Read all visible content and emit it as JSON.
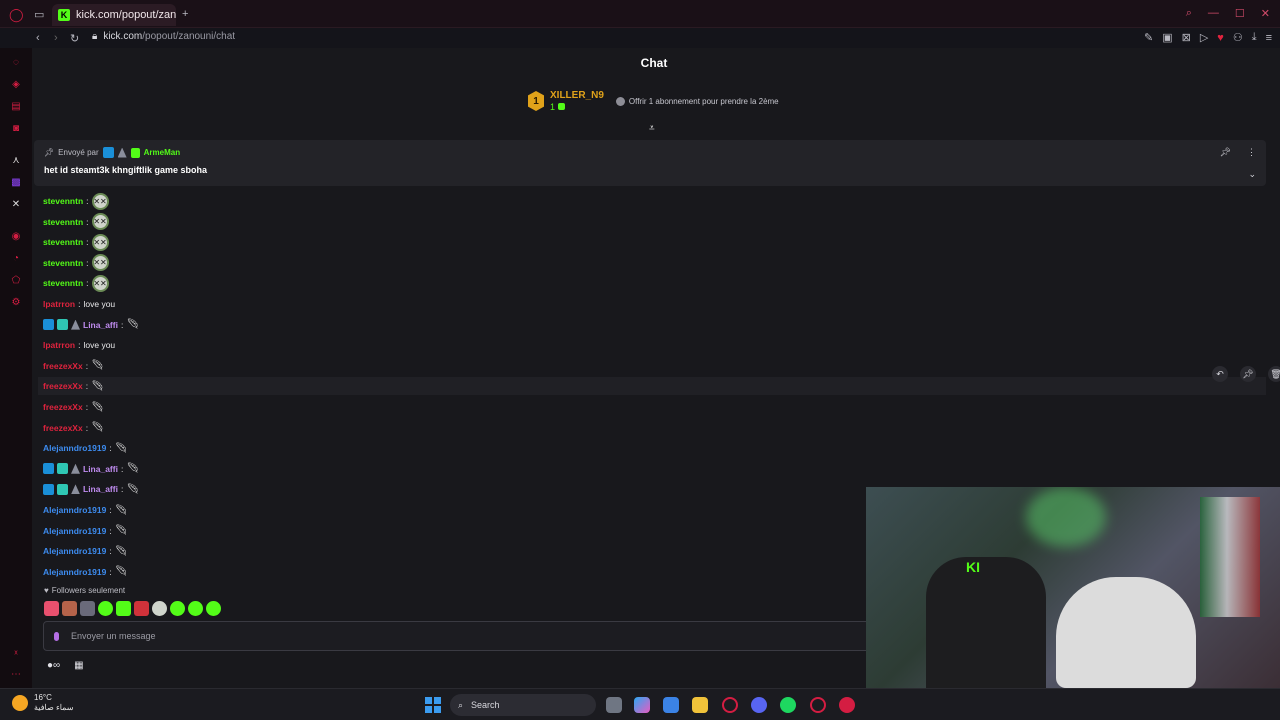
{
  "browser": {
    "tab_title": "kick.com/popout/zanouni",
    "tab_favicon": "K",
    "url_host": "kick.com",
    "url_path": "/popout/zanouni/chat"
  },
  "chat": {
    "title": "Chat",
    "gifter": {
      "rank": "1",
      "name": "XILLER_N9",
      "count": "1",
      "offer": "Offrir 1 abonnement pour prendre la 2ème"
    },
    "pinned": {
      "sent_by_label": "Envoyé par",
      "user": "ArmeMan",
      "text": "het id steamt3k khngiftlik game sboha"
    },
    "messages": [
      {
        "user": "stevenntn",
        "color": "#53fc18",
        "text": "",
        "emote": "face",
        "badges": ""
      },
      {
        "user": "stevenntn",
        "color": "#53fc18",
        "text": "",
        "emote": "face",
        "badges": ""
      },
      {
        "user": "stevenntn",
        "color": "#53fc18",
        "text": "",
        "emote": "face",
        "badges": ""
      },
      {
        "user": "stevenntn",
        "color": "#53fc18",
        "text": "",
        "emote": "face",
        "badges": ""
      },
      {
        "user": "stevenntn",
        "color": "#53fc18",
        "text": "",
        "emote": "face",
        "badges": ""
      },
      {
        "user": "lpatrron",
        "color": "#e0233e",
        "text": "love you",
        "emote": "",
        "badges": ""
      },
      {
        "user": "Lina_affi",
        "color": "#c08cf0",
        "text": "",
        "emote": "feather",
        "badges": "three"
      },
      {
        "user": "lpatrron",
        "color": "#e0233e",
        "text": "love you",
        "emote": "",
        "badges": ""
      },
      {
        "user": "freezexXx",
        "color": "#e0233e",
        "text": "",
        "emote": "feather",
        "badges": ""
      },
      {
        "user": "freezexXx",
        "color": "#e0233e",
        "text": "",
        "emote": "feather",
        "badges": "",
        "highlight": true
      },
      {
        "user": "freezexXx",
        "color": "#e0233e",
        "text": "",
        "emote": "feather",
        "badges": ""
      },
      {
        "user": "freezexXx",
        "color": "#e0233e",
        "text": "",
        "emote": "feather",
        "badges": ""
      },
      {
        "user": "Alejanndro1919",
        "color": "#3d8cf0",
        "text": "",
        "emote": "feather",
        "badges": ""
      },
      {
        "user": "Lina_affi",
        "color": "#c08cf0",
        "text": "",
        "emote": "feather",
        "badges": "three"
      },
      {
        "user": "Lina_affi",
        "color": "#c08cf0",
        "text": "",
        "emote": "feather",
        "badges": "three"
      },
      {
        "user": "Alejanndro1919",
        "color": "#3d8cf0",
        "text": "",
        "emote": "feather",
        "badges": ""
      },
      {
        "user": "Alejanndro1919",
        "color": "#3d8cf0",
        "text": "",
        "emote": "feather",
        "badges": ""
      },
      {
        "user": "Alejanndro1919",
        "color": "#3d8cf0",
        "text": "",
        "emote": "feather",
        "badges": ""
      },
      {
        "user": "Alejanndro1919",
        "color": "#3d8cf0",
        "text": "",
        "emote": "feather",
        "badges": ""
      }
    ],
    "followers_only": "Followers seulement",
    "composer_placeholder": "Envoyer un message"
  },
  "taskbar": {
    "temperature": "16°C",
    "condition": "سماء صافية",
    "search_label": "Search"
  },
  "colors": {
    "kick_green": "#53fc18",
    "opera_red": "#d41d42",
    "gifter_gold": "#e0a21a"
  }
}
